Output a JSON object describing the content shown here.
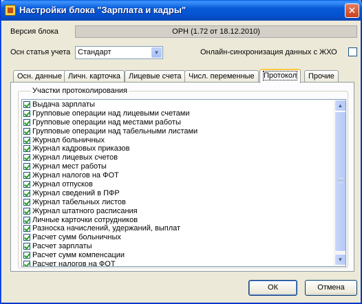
{
  "window": {
    "title": "Настройки блока \"Зарплата и кадры\"",
    "close_glyph": "✕"
  },
  "version": {
    "label": "Версия блока",
    "value": "ОРН   (1.72 от 18.12.2010)"
  },
  "main_account": {
    "label": "Осн статья учета",
    "selected": "Стандарт"
  },
  "sync": {
    "label": "Онлайн-синхронизация данных с ЖХО",
    "checked": false
  },
  "tabs": [
    {
      "label": "Осн. данные"
    },
    {
      "label": "Личн. карточка"
    },
    {
      "label": "Лицевые счета"
    },
    {
      "label": "Числ. переменные"
    },
    {
      "label": "Протокол",
      "active": true
    },
    {
      "label": "Прочие"
    }
  ],
  "protocol": {
    "group_label": "Участки протоколирования",
    "items": [
      {
        "label": "Выдача зарплаты",
        "checked": true
      },
      {
        "label": "Групповые операции над лицевыми счетами",
        "checked": true
      },
      {
        "label": "Групповые операции над местами работы",
        "checked": true
      },
      {
        "label": "Групповые операции над табельными листами",
        "checked": true
      },
      {
        "label": "Журнал больничных",
        "checked": true
      },
      {
        "label": "Журнал кадровых приказов",
        "checked": true
      },
      {
        "label": "Журнал лицевых счетов",
        "checked": true
      },
      {
        "label": "Журнал мест работы",
        "checked": true
      },
      {
        "label": "Журнал налогов на ФОТ",
        "checked": true
      },
      {
        "label": "Журнал отпусков",
        "checked": true
      },
      {
        "label": "Журнал сведений в ПФР",
        "checked": true
      },
      {
        "label": "Журнал табельных листов",
        "checked": true
      },
      {
        "label": "Журнал штатного расписания",
        "checked": true
      },
      {
        "label": "Личные карточки сотрудников",
        "checked": true
      },
      {
        "label": "Разноска начислений, удержаний, выплат",
        "checked": true
      },
      {
        "label": "Расчет сумм больничных",
        "checked": true
      },
      {
        "label": "Расчет зарплаты",
        "checked": true
      },
      {
        "label": "Расчет сумм компенсации",
        "checked": true
      },
      {
        "label": "Расчет налогов на ФОТ",
        "checked": true
      }
    ]
  },
  "buttons": {
    "ok": "ОК",
    "cancel": "Отмена"
  },
  "icons": {
    "app": "app-icon",
    "combo_arrow": "▼",
    "scroll_up": "▲",
    "scroll_down": "▼"
  }
}
